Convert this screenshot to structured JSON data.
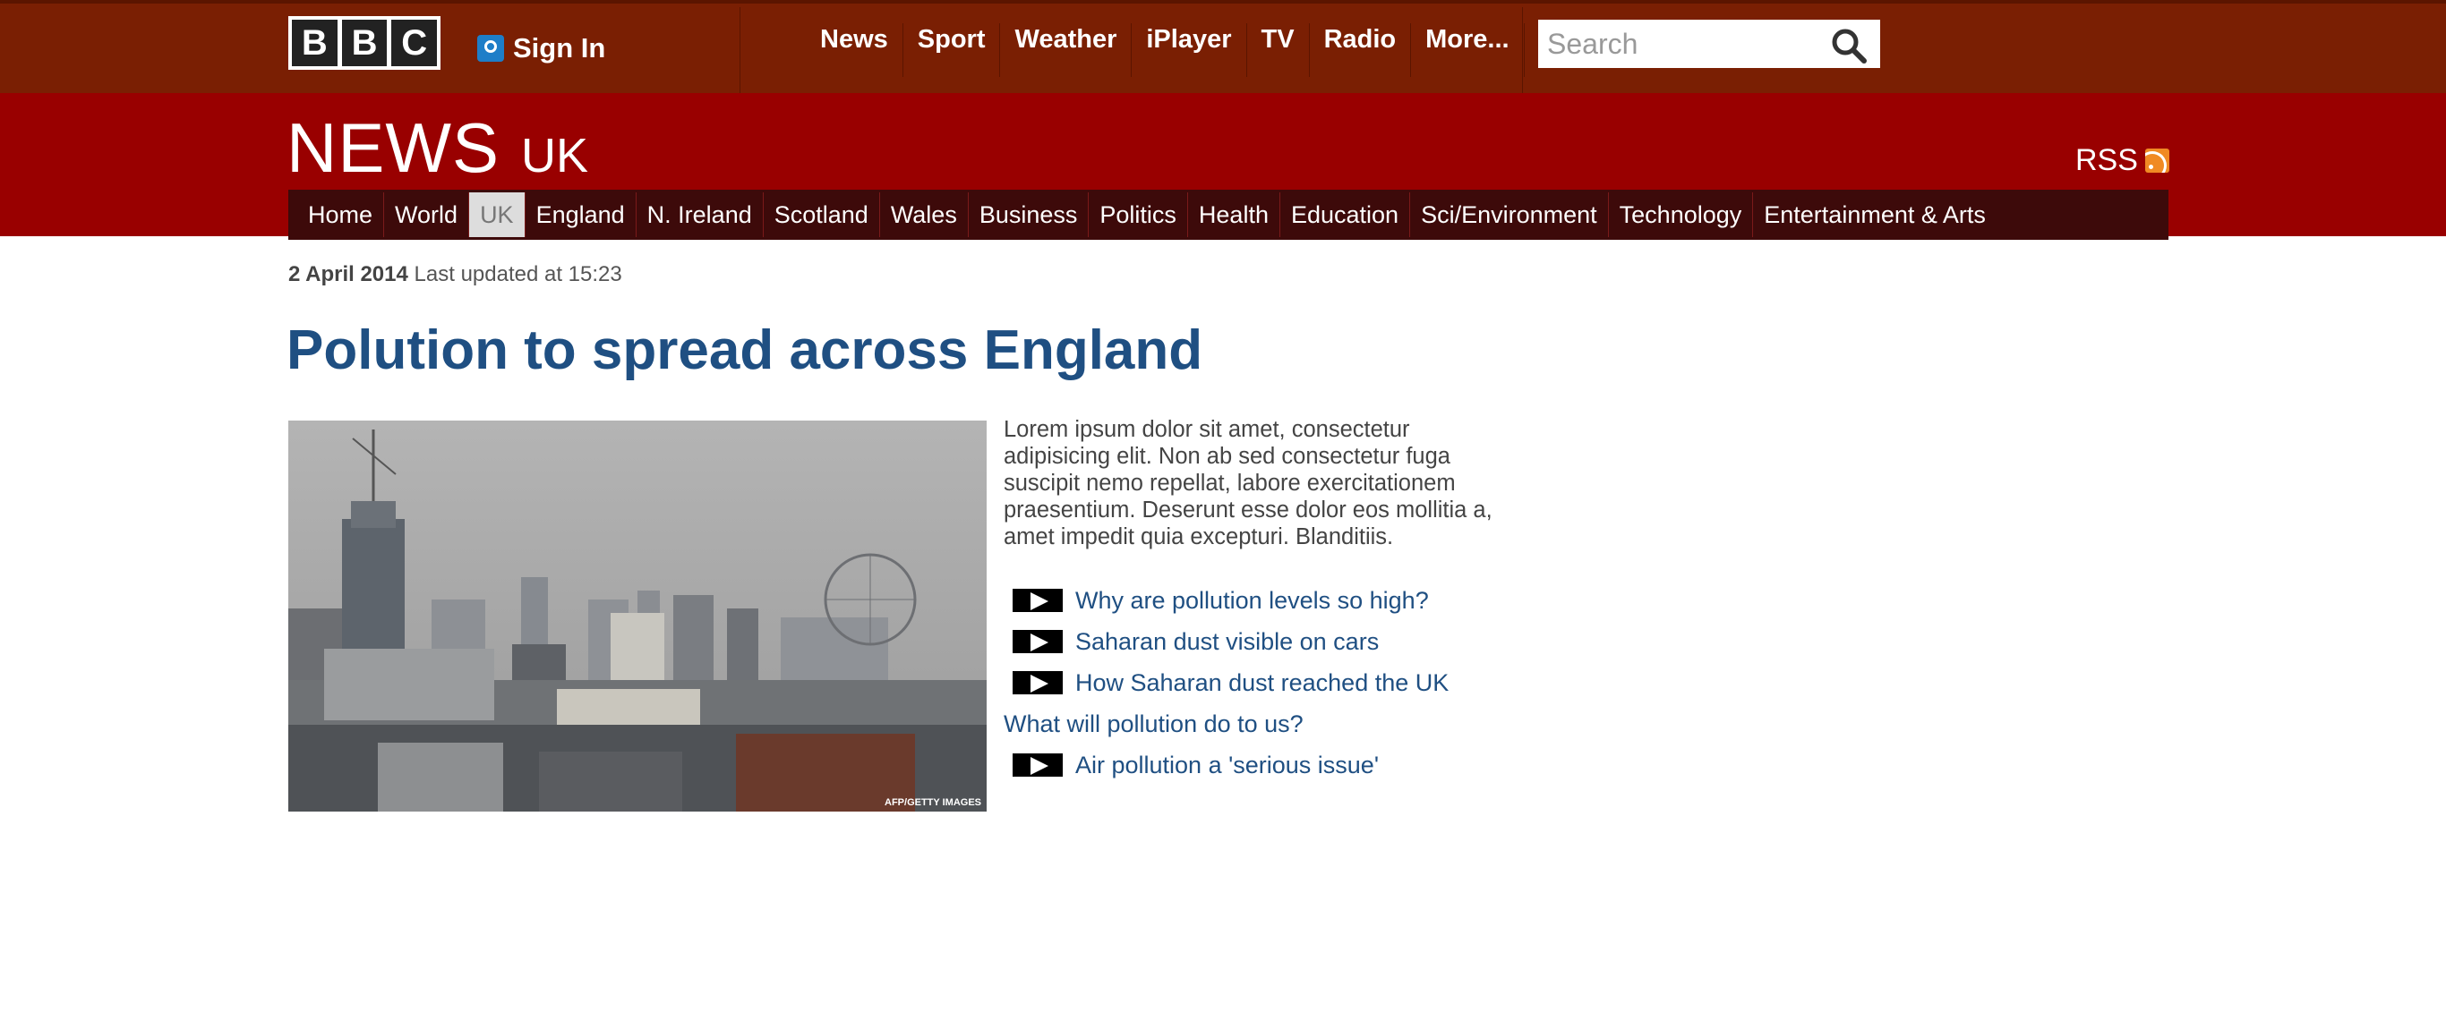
{
  "topbar": {
    "logo_letters": [
      "B",
      "B",
      "C"
    ],
    "signin_label": "Sign In",
    "nav": [
      "News",
      "Sport",
      "Weather",
      "iPlayer",
      "TV",
      "Radio",
      "More..."
    ],
    "search_placeholder": "Search"
  },
  "section": {
    "title": "NEWS",
    "subtitle": "UK",
    "rss_label": "RSS",
    "subnav": [
      "Home",
      "World",
      "UK",
      "England",
      "N. Ireland",
      "Scotland",
      "Wales",
      "Business",
      "Politics",
      "Health",
      "Education",
      "Sci/Environment",
      "Technology",
      "Entertainment & Arts"
    ],
    "active_subnav": "UK"
  },
  "article": {
    "date": "2 April 2014",
    "updated": "Last updated at 15:23",
    "headline": "Polution to spread across England",
    "photo_credit": "AFP/GETTY IMAGES",
    "summary": "Lorem ipsum dolor sit amet, consectetur adipisicing elit. Non ab sed consectetur fuga suscipit nemo repellat, labore exercitationem praesentium. Deserunt esse dolor eos mollitia a, amet impedit quia excepturi. Blanditiis.",
    "links": [
      {
        "label": "Why are pollution levels so high?",
        "video": true
      },
      {
        "label": "Saharan dust visible on cars",
        "video": true
      },
      {
        "label": "How Saharan dust reached the UK",
        "video": true
      },
      {
        "label": "What will pollution do to us?",
        "video": false
      },
      {
        "label": "Air pollution a 'serious issue'",
        "video": true
      }
    ]
  },
  "colors": {
    "topbar": "#7a1f03",
    "newsband": "#990000",
    "subnav": "#3d0a0a",
    "headline": "#1f4f82",
    "rss": "#f08a24"
  }
}
